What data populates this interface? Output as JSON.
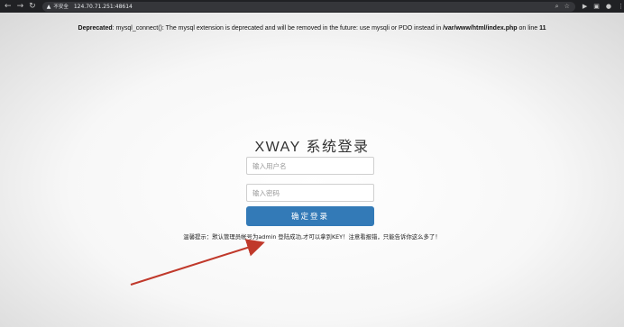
{
  "browser": {
    "insecure_label": "不安全",
    "url": "124.70.71.251:48614"
  },
  "page": {
    "deprecated_label": "Deprecated",
    "deprecated_message": ": mysql_connect(): The mysql extension is deprecated and will be removed in the future: use mysqli or PDO instead in ",
    "deprecated_path": "/var/www/html/index.php",
    "deprecated_line_prefix": " on line ",
    "deprecated_line": "11",
    "title": "XWAY 系统登录",
    "username_placeholder": "输入用户名",
    "password_placeholder": "输入密码",
    "submit_label": "确定登录",
    "tip": "温馨提示：默认管理员帐号为admin 登陆成功,才可以拿到KEY！注意看报错，只能告诉你这么多了！"
  },
  "icons": {
    "back": "back-arrow-icon",
    "forward": "forward-arrow-icon",
    "reload": "reload-icon",
    "warning": "warning-icon",
    "search": "search-icon",
    "star": "star-icon"
  },
  "colors": {
    "submit_bg": "#337ab7",
    "arrow": "#c0392b"
  }
}
